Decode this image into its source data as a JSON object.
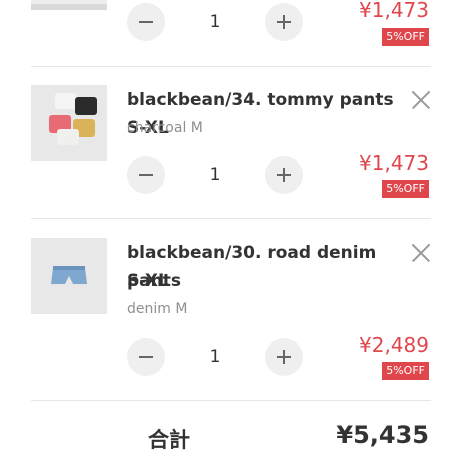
{
  "items": [
    {
      "quantity": "1",
      "price": "¥1,473",
      "discount_badge": "5%OFF"
    },
    {
      "name": "blackbean/34. tommy pants S-XL",
      "variant": "charcoal M",
      "quantity": "1",
      "price": "¥1,473",
      "discount_badge": "5%OFF"
    },
    {
      "name_line1": "blackbean/30. road denim pants",
      "name_line2": "S-XL",
      "variant": "denim M",
      "quantity": "1",
      "price": "¥2,489",
      "discount_badge": "5%OFF"
    }
  ],
  "total": {
    "label": "合計",
    "value": "¥5,435"
  },
  "colors": {
    "price": "#e0474c",
    "badge_bg": "#e0474c",
    "stepper_bg": "#efefef"
  },
  "icons": [
    "minus-icon",
    "plus-icon",
    "close-icon"
  ]
}
